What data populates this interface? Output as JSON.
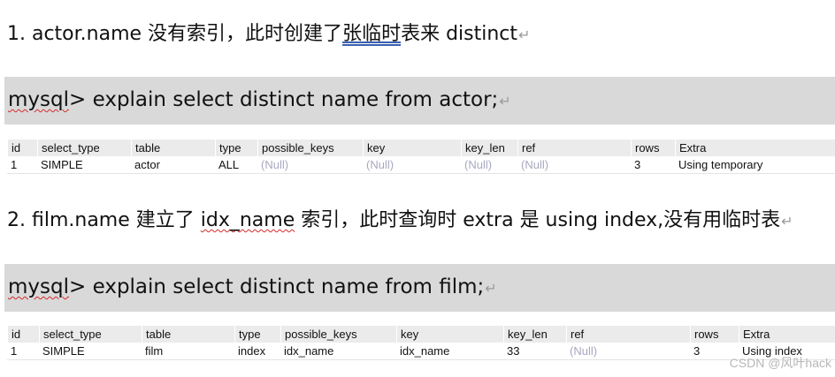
{
  "section1": {
    "prefix": "1. actor.name 没有索引，此时创建了",
    "underlined": "张临时",
    "suffix": "表来 distinct",
    "mark": "↵"
  },
  "command1": {
    "underlined": "mysql",
    "rest": "> explain select distinct name from actor;",
    "mark": "↵"
  },
  "table1": {
    "columns": [
      "id",
      "select_type",
      "table",
      "type",
      "possible_keys",
      "key",
      "key_len",
      "ref",
      "rows",
      "Extra"
    ],
    "rows": [
      [
        "1",
        "SIMPLE",
        "actor",
        "ALL",
        "(Null)",
        "(Null)",
        "(Null)",
        "(Null)",
        "3",
        "Using temporary"
      ]
    ]
  },
  "section2": {
    "prefix": "2. film.name 建立了 ",
    "underlined": "idx_name",
    "suffix": " 索引，此时查询时 extra 是 using index,没有用临时表",
    "mark": "↵"
  },
  "command2": {
    "underlined": "mysql",
    "rest": "> explain select distinct name from film;",
    "mark": "↵"
  },
  "table2": {
    "columns": [
      "id",
      "select_type",
      "table",
      "type",
      "possible_keys",
      "key",
      "key_len",
      "ref",
      "rows",
      "Extra"
    ],
    "rows": [
      [
        "1",
        "SIMPLE",
        "film",
        "index",
        "idx_name",
        "idx_name",
        "33",
        "(Null)",
        "3",
        "Using index"
      ]
    ]
  },
  "watermark": "CSDN @风叶hack",
  "colors": {
    "command_background": "#d9d9d9",
    "null_text": "#a8a8c0",
    "spell_underline": "#d42a2a",
    "grammar_underline": "#3a5fb0"
  }
}
